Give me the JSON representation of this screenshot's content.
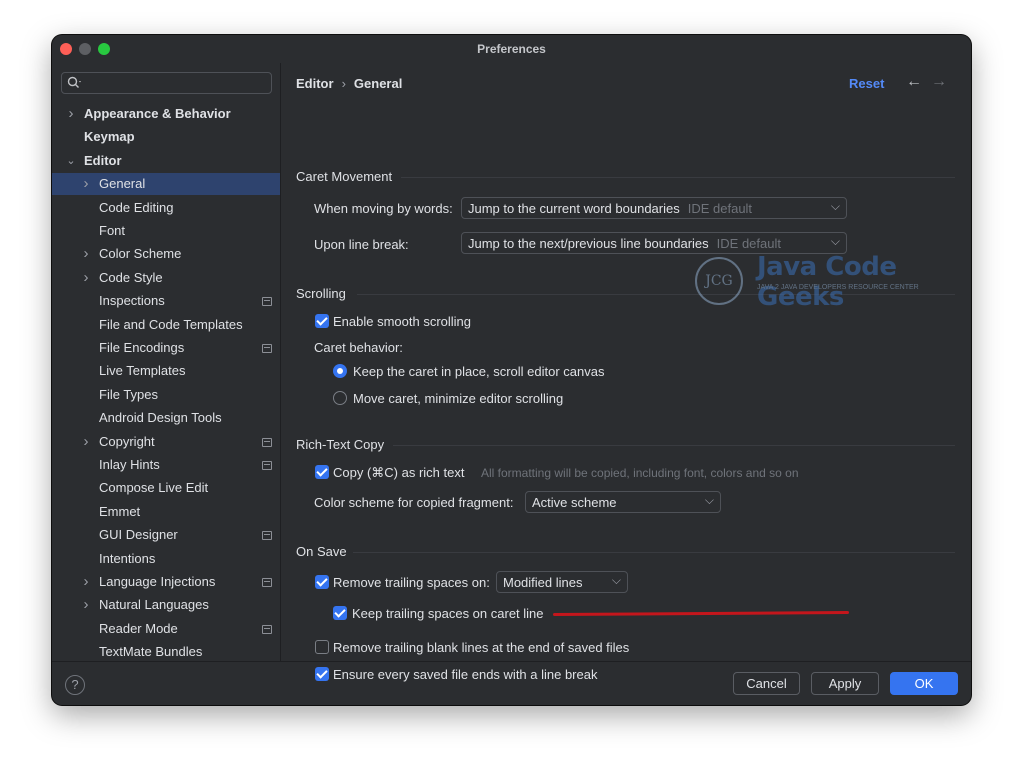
{
  "window": {
    "title": "Preferences"
  },
  "search": {
    "placeholder": ""
  },
  "sidebar": {
    "items": [
      {
        "label": "Appearance & Behavior",
        "bold": true,
        "chevron": "right",
        "level": 0
      },
      {
        "label": "Keymap",
        "bold": true,
        "chevron": "",
        "level": 0
      },
      {
        "label": "Editor",
        "bold": true,
        "chevron": "down",
        "level": 0
      },
      {
        "label": "General",
        "chevron": "right",
        "level": 1,
        "selected": true
      },
      {
        "label": "Code Editing",
        "level": 1
      },
      {
        "label": "Font",
        "level": 1
      },
      {
        "label": "Color Scheme",
        "chevron": "right",
        "level": 1
      },
      {
        "label": "Code Style",
        "chevron": "right",
        "level": 1
      },
      {
        "label": "Inspections",
        "level": 1,
        "page_icon": true
      },
      {
        "label": "File and Code Templates",
        "level": 1
      },
      {
        "label": "File Encodings",
        "level": 1,
        "page_icon": true
      },
      {
        "label": "Live Templates",
        "level": 1
      },
      {
        "label": "File Types",
        "level": 1
      },
      {
        "label": "Android Design Tools",
        "level": 1
      },
      {
        "label": "Copyright",
        "chevron": "right",
        "level": 1,
        "page_icon": true
      },
      {
        "label": "Inlay Hints",
        "level": 1,
        "page_icon": true
      },
      {
        "label": "Compose Live Edit",
        "level": 1
      },
      {
        "label": "Emmet",
        "level": 1
      },
      {
        "label": "GUI Designer",
        "level": 1,
        "page_icon": true
      },
      {
        "label": "Intentions",
        "level": 1
      },
      {
        "label": "Language Injections",
        "chevron": "right",
        "level": 1,
        "page_icon": true
      },
      {
        "label": "Natural Languages",
        "chevron": "right",
        "level": 1
      },
      {
        "label": "Reader Mode",
        "level": 1,
        "page_icon": true
      },
      {
        "label": "TextMate Bundles",
        "level": 1
      }
    ]
  },
  "header": {
    "breadcrumb": [
      "Editor",
      "General"
    ],
    "breadcrumb_sep": "›",
    "reset_label": "Reset",
    "back_icon": "←",
    "forward_icon": "→"
  },
  "caret_movement": {
    "title": "Caret Movement",
    "moving_by_words_label": "When moving by words:",
    "moving_by_words_value": "Jump to the current word boundaries",
    "moving_by_words_hint": "IDE default",
    "line_break_label": "Upon line break:",
    "line_break_value": "Jump to the next/previous line boundaries",
    "line_break_hint": "IDE default"
  },
  "scrolling": {
    "title": "Scrolling",
    "smooth_scrolling_label": "Enable smooth scrolling",
    "smooth_scrolling_checked": true,
    "caret_behavior_label": "Caret behavior:",
    "option_keep_caret": "Keep the caret in place, scroll editor canvas",
    "option_move_caret": "Move caret, minimize editor scrolling",
    "selected_option": "keep"
  },
  "rich_text_copy": {
    "title": "Rich-Text Copy",
    "copy_label": "Copy (⌘C) as rich text",
    "copy_checked": true,
    "copy_hint": "All formatting will be copied, including font, colors and so on",
    "color_scheme_label": "Color scheme for copied fragment:",
    "color_scheme_value": "Active scheme"
  },
  "on_save": {
    "title": "On Save",
    "remove_trailing_label": "Remove trailing spaces on:",
    "remove_trailing_checked": true,
    "remove_trailing_value": "Modified lines",
    "keep_trailing_label": "Keep trailing spaces on caret line",
    "keep_trailing_checked": true,
    "remove_blank_lines_label": "Remove trailing blank lines at the end of saved files",
    "remove_blank_lines_checked": false,
    "ensure_line_break_label": "Ensure every saved file ends with a line break",
    "ensure_line_break_checked": true
  },
  "watermark": {
    "logo_mark": "JCG",
    "title": "Java Code Geeks",
    "subtitle": "JAVA 2 JAVA DEVELOPERS RESOURCE CENTER"
  },
  "footer": {
    "help_label": "?",
    "cancel_label": "Cancel",
    "apply_label": "Apply",
    "ok_label": "OK"
  },
  "colors": {
    "background": "#2b2d30",
    "selection": "#2e436e",
    "accent": "#3574f0",
    "link": "#548af7",
    "annotation_red": "#c4161c"
  },
  "icons": {
    "search": "search-icon",
    "dropdown": "chevron-down-icon",
    "tree_expand": "chevron-right-icon",
    "tree_collapse": "chevron-down-icon",
    "project_level": "page-icon"
  }
}
